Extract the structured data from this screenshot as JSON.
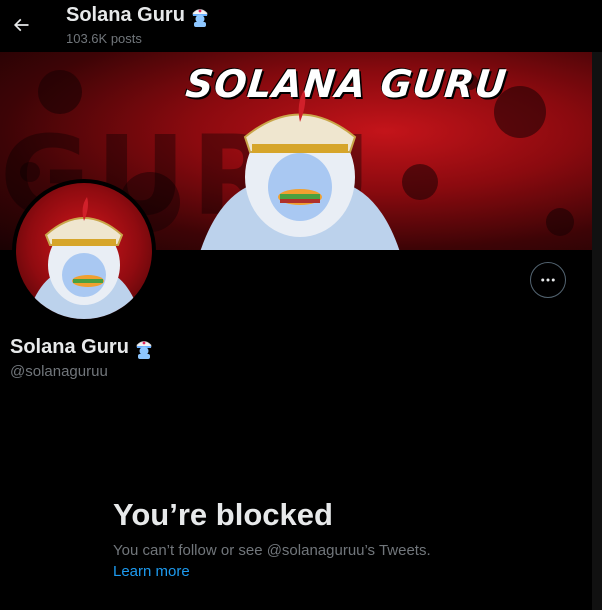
{
  "header": {
    "title": "Solana Guru",
    "posts_count": "103.6K posts",
    "back_icon": "back-arrow-icon"
  },
  "banner": {
    "text": "SOLANA GURU",
    "background_text": "GURU",
    "colors": {
      "primary": "#c4141a",
      "dark": "#3d0406"
    }
  },
  "profile": {
    "name": "Solana Guru",
    "handle": "@solanaguruu",
    "name_emoji_icon": "guru-emoji-icon",
    "more_icon": "more-options-icon"
  },
  "blocked": {
    "title": "You’re blocked",
    "description": "You can’t follow or see @solanaguruu’s Tweets.",
    "learn_more": "Learn more"
  },
  "colors": {
    "background": "#000000",
    "text_primary": "#e7e9ea",
    "text_secondary": "#71767b",
    "link": "#1d9bf0",
    "border": "#536471"
  }
}
